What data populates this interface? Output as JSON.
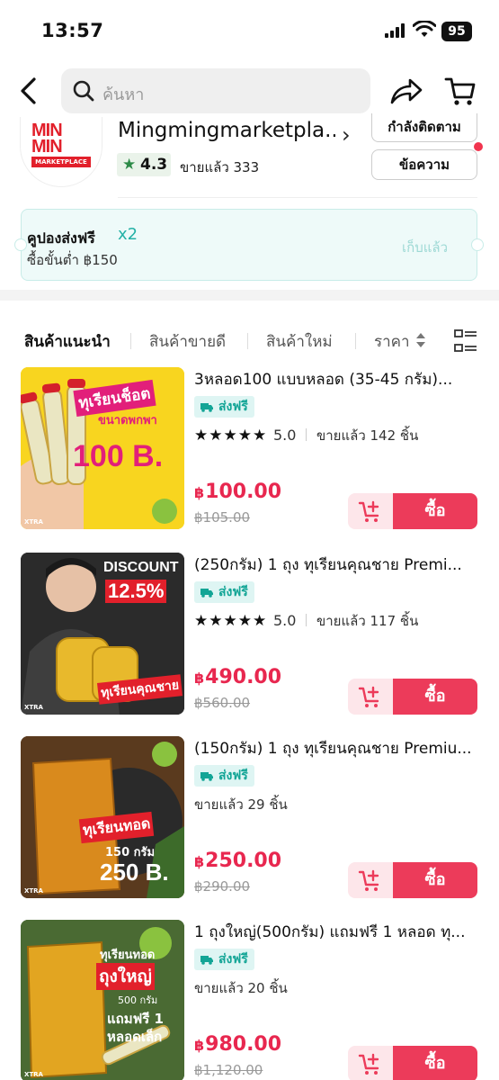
{
  "status_bar": {
    "time": "13:57",
    "battery": "95"
  },
  "header": {
    "search_placeholder": "ค้นหา"
  },
  "shop": {
    "logo_text": "MIN MIN",
    "logo_sub": "MARKETPLACE",
    "name": "Mingmingmarketpla...",
    "rating": "4.3",
    "sold": "ขายแล้ว 333",
    "follow_label": "กำลังติดตาม",
    "message_label": "ข้อความ"
  },
  "coupon": {
    "title": "คูปองส่งฟรี",
    "multiplier": "x2",
    "min_spend": "ซื้อขั้นต่ำ ฿150",
    "status": "เก็บแล้ว"
  },
  "tabs": [
    "สินค้าแนะนำ",
    "สินค้าขายดี",
    "สินค้าใหม่",
    "ราคา"
  ],
  "products": [
    {
      "title": "3หลอด100 แบบหลอด (35-45 กรัม)...",
      "shipping": "ส่งฟรี",
      "stars": "★★★★★",
      "rating": "5.0",
      "sold": "ขายแล้ว 142 ชิ้น",
      "price": "100.00",
      "original_price": "฿105.00",
      "buy_label": "ซื้อ",
      "img_line1": "ทุเรียนช็อต",
      "img_line2": "ขนาดพกพา",
      "img_line3": "100 B."
    },
    {
      "title": "(250กรัม) 1 ถุง ทุเรียนคุณชาย Premi...",
      "shipping": "ส่งฟรี",
      "stars": "★★★★★",
      "rating": "5.0",
      "sold": "ขายแล้ว 117 ชิ้น",
      "price": "490.00",
      "original_price": "฿560.00",
      "buy_label": "ซื้อ",
      "img_line1": "DISCOUNT",
      "img_line2": "12.5%",
      "img_line3": "ทุเรียนคุณชาย"
    },
    {
      "title": "(150กรัม) 1 ถุง ทุเรียนคุณชาย Premiu...",
      "shipping": "ส่งฟรี",
      "sold": "ขายแล้ว 29 ชิ้น",
      "price": "250.00",
      "original_price": "฿290.00",
      "buy_label": "ซื้อ",
      "img_line1": "ทุเรียนทอด",
      "img_line2": "150 กรัม",
      "img_line3": "250 B."
    },
    {
      "title": "1 ถุงใหญ่(500กรัม) แถมฟรี 1 หลอด ทุ...",
      "shipping": "ส่งฟรี",
      "sold": "ขายแล้ว 20 ชิ้น",
      "price": "980.00",
      "original_price": "฿1,120.00",
      "buy_label": "ซื้อ",
      "img_line1": "ทุเรียนทอด",
      "img_line2": "ถุงใหญ่",
      "img_line3": "500 กรัม",
      "img_line4": "แถมฟรี 1",
      "img_line5": "หลอดเล็ก"
    }
  ],
  "xtra_badge": "XTRA",
  "colors": {
    "accent_red": "#ec3b5a",
    "price_red": "#e8274f",
    "teal": "#13a596"
  },
  "icons": [
    "back-icon",
    "search-icon",
    "share-icon",
    "cart-icon",
    "star-icon",
    "truck-icon",
    "add-to-cart-icon",
    "grid-view-icon",
    "sort-icon"
  ]
}
